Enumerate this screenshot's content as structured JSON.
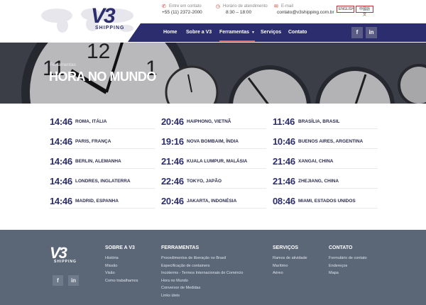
{
  "brand": {
    "logo_text": "V3",
    "logo_sub": "SHIPPING"
  },
  "contacts": [
    {
      "label": "Entre em contato",
      "value": "+55 (11) 2372-2000",
      "icon": "phone-icon"
    },
    {
      "label": "Horário de atendimento",
      "value": "8:30 – 18:00",
      "icon": "clock-icon"
    },
    {
      "label": "E-mail",
      "value": "contato@v3shipping.com.br",
      "icon": "mail-icon"
    }
  ],
  "languages": {
    "english": "ENGLISH",
    "chinese": "中國語文"
  },
  "nav": {
    "home": "Home",
    "sobre": "Sobre a V3",
    "ferramentas": "Ferramentas",
    "ferramentas_arrow": "▼",
    "servicos": "Serviços",
    "contato": "Contato"
  },
  "social": {
    "facebook": "f",
    "linkedin": "in"
  },
  "hero": {
    "breadcrumb": "Ferramentas",
    "title": "HORA NO MUNDO"
  },
  "world_times": [
    [
      {
        "time": "14:46",
        "city": "ROMA, ITÁLIA"
      },
      {
        "time": "14:46",
        "city": "PARIS, FRANÇA"
      },
      {
        "time": "14:46",
        "city": "BERLIN, ALEMANHA"
      },
      {
        "time": "14:46",
        "city": "LONDRES, INGLATERRA"
      },
      {
        "time": "14:46",
        "city": "MADRID, ESPANHA"
      }
    ],
    [
      {
        "time": "20:46",
        "city": "HAIPHONG, VIETNÃ"
      },
      {
        "time": "19:16",
        "city": "NOVA BOMBAIM, ÍNDIA"
      },
      {
        "time": "21:46",
        "city": "KUALA LUMPUR, MALÁSIA"
      },
      {
        "time": "22:46",
        "city": "TOKYO, JAPÃO"
      },
      {
        "time": "20:46",
        "city": "JAKARTA, INDONÉSIA"
      }
    ],
    [
      {
        "time": "11:46",
        "city": "BRASÍLIA, BRASIL"
      },
      {
        "time": "10:46",
        "city": "BUENOS AIRES, ARGENTINA"
      },
      {
        "time": "21:46",
        "city": "XANGAI, CHINA"
      },
      {
        "time": "21:46",
        "city": "ZHEJIANG, CHINA"
      },
      {
        "time": "08:46",
        "city": "MIAMI, ESTADOS UNIDOS"
      }
    ]
  ],
  "footer": {
    "logo_text": "V3",
    "logo_sub": "SHIPPING",
    "columns": [
      {
        "title": "SOBRE A V3",
        "links": [
          "História",
          "Missão",
          "Visão",
          "Como trabalhamos"
        ]
      },
      {
        "title": "FERRAMENTAS",
        "links": [
          "Procedimentos de liberação no Brasil",
          "Especificação de containers",
          "Incoterms - Termos Internacionais de Comércio",
          "Hora no Mundo",
          "Conversor de Medidas",
          "Links úteis"
        ]
      },
      {
        "title": "SERVIÇOS",
        "links": [
          "Ramos de atividade",
          "Marítimo",
          "Aéreo"
        ]
      },
      {
        "title": "CONTATO",
        "links": [
          "Formulário de contato",
          "Endereços",
          "Mapa"
        ]
      }
    ]
  },
  "colors": {
    "brand_navy": "#2b2d6e",
    "accent_red": "#e65c4f",
    "footer_bg": "#5b6677"
  }
}
